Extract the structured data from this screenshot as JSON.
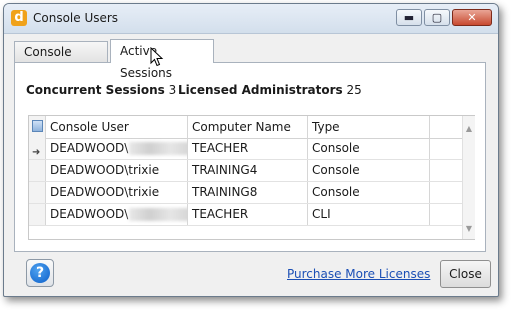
{
  "window": {
    "title": "Console Users",
    "app_icon_letter": "d",
    "controls": {
      "minimize": "▬",
      "maximize": "▢",
      "close": "✕"
    }
  },
  "tabs": [
    {
      "label": "Console Users",
      "active": false
    },
    {
      "label": "Active Sessions",
      "active": true
    }
  ],
  "stats": {
    "concurrent_label": "Concurrent Sessions",
    "concurrent_value": "3",
    "licensed_label": "Licensed Administrators",
    "licensed_value": "25"
  },
  "grid": {
    "columns": [
      "Console User",
      "Computer Name",
      "Type"
    ],
    "rows": [
      {
        "user": "DEADWOOD\\",
        "user_redacted": true,
        "computer": "TEACHER",
        "type": "Console",
        "current": true
      },
      {
        "user": "DEADWOOD\\trixie",
        "user_redacted": false,
        "computer": "TRAINING4",
        "type": "Console",
        "current": false
      },
      {
        "user": "DEADWOOD\\trixie",
        "user_redacted": false,
        "computer": "TRAINING8",
        "type": "Console",
        "current": false
      },
      {
        "user": "DEADWOOD\\",
        "user_redacted": true,
        "computer": "TEACHER",
        "type": "CLI",
        "current": false
      }
    ]
  },
  "footer": {
    "help_glyph": "?",
    "link_label": "Purchase More Licenses",
    "close_label": "Close"
  },
  "colors": {
    "link": "#1b4fb5",
    "app_icon": "#f0a21a",
    "close_button": "#c84a30"
  }
}
